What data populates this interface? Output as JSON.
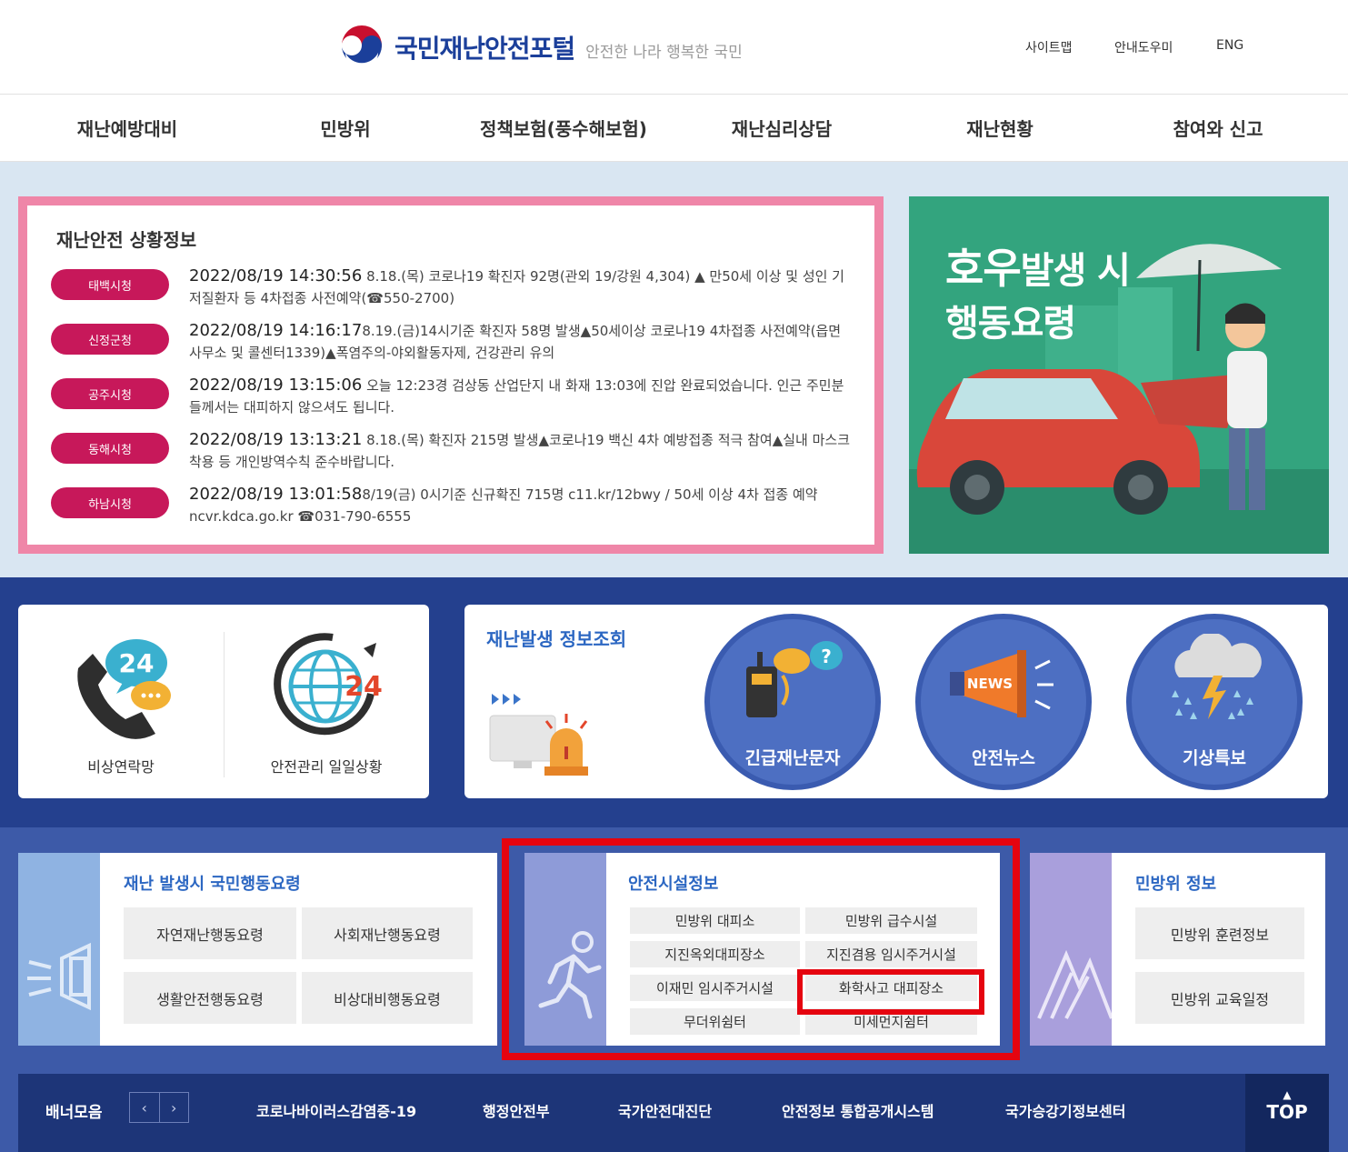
{
  "header": {
    "site_title": "국민재난안전포털",
    "slogan": "안전한 나라 행복한 국민",
    "util": [
      "사이트맵",
      "안내도우미",
      "ENG"
    ]
  },
  "gnb": [
    "재난예방대비",
    "민방위",
    "정책보험(풍수해보험)",
    "재난심리상담",
    "재난현황",
    "참여와 신고"
  ],
  "alerts": {
    "title": "재난안전 상황정보",
    "items": [
      {
        "region": "태백시청",
        "time": "2022/08/19 14:30:56",
        "text": " 8.18.(목) 코로나19 확진자 92명(관외 19/강원 4,304) ▲ 만50세 이상 및 성인 기저질환자 등 4차접종 사전예약(☎550-2700)"
      },
      {
        "region": "신정군청",
        "time": "2022/08/19 14:16:17",
        "text": "8.19.(금)14시기준 확진자 58명 발생▲50세이상 코로나19 4차접종 사전예약(읍면사무소 및 콜센터1339)▲폭염주의-야외활동자제, 건강관리 유의"
      },
      {
        "region": "공주시청",
        "time": "2022/08/19 13:15:06",
        "text": " 오늘 12:23경 검상동 산업단지 내 화재 13:03에 진압 완료되었습니다. 인근 주민분들께서는 대피하지 않으셔도 됩니다."
      },
      {
        "region": "동해시청",
        "time": "2022/08/19 13:13:21",
        "text": " 8.18.(목) 확진자 215명 발생▲코로나19 백신 4차 예방접종 적극 참여▲실내 마스크 착용 등 개인방역수칙 준수바랍니다."
      },
      {
        "region": "하남시청",
        "time": "2022/08/19 13:01:58",
        "text": "8/19(금) 0시기준 신규확진 715명 c11.kr/12bwy / 50세 이상 4차 접종 예약 ncvr.kdca.go.kr ☎031-790-6555"
      }
    ]
  },
  "banner": {
    "line1_big": "호우",
    "line1_rest": "발생 시",
    "line2": "행동요령"
  },
  "quick": {
    "emergency_contact": "비상연락망",
    "daily_status": "안전관리 일일상황",
    "badge_24": "24",
    "inquiry_title": "재난발생 정보조회",
    "circles": [
      "긴급재난문자",
      "안전뉴스",
      "기상특보"
    ],
    "news_badge": "NEWS"
  },
  "panels": {
    "action": {
      "title": "재난 발생시 국민행동요령",
      "buttons": [
        "자연재난행동요령",
        "사회재난행동요령",
        "생활안전행동요령",
        "비상대비행동요령"
      ]
    },
    "facility": {
      "title": "안전시설정보",
      "buttons": [
        "민방위 대피소",
        "민방위 급수시설",
        "지진옥외대피장소",
        "지진겸용 임시주거시설",
        "이재민 임시주거시설",
        "화학사고 대피장소",
        "무더위쉼터",
        "미세먼지쉼터"
      ]
    },
    "civil": {
      "title": "민방위 정보",
      "buttons": [
        "민방위 훈련정보",
        "민방위 교육일정"
      ]
    }
  },
  "bottom": {
    "label": "배너모음",
    "prev": "‹",
    "next": "›",
    "links": [
      "코로나바이러스감염증-19",
      "행정안전부",
      "국가안전대진단",
      "안전정보 통합공개시스템",
      "국가승강기정보센터"
    ],
    "top_arrow": "▲",
    "top": "TOP"
  },
  "colors": {
    "brand_blue": "#1b3f9a",
    "alert_pink": "#c7185a",
    "highlight_red": "#e5040f"
  }
}
